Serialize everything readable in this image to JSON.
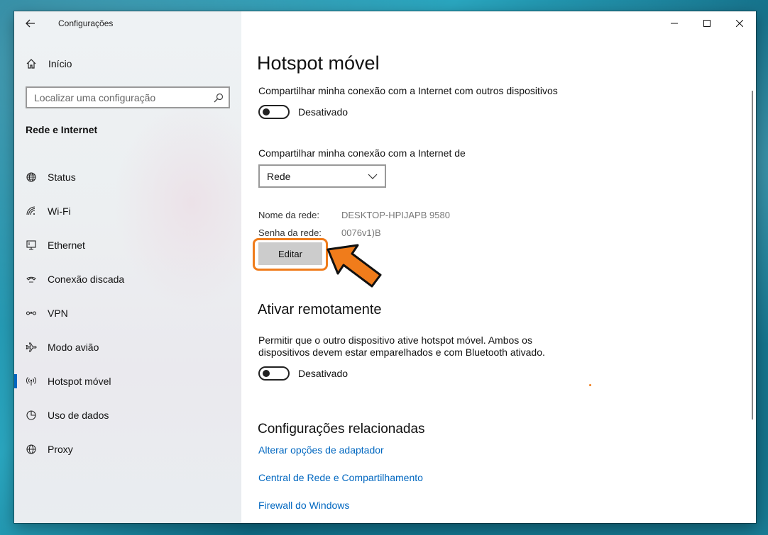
{
  "window": {
    "app_title": "Configurações"
  },
  "sidebar": {
    "home_label": "Início",
    "search_placeholder": "Localizar uma configuração",
    "section_title": "Rede e Internet",
    "items": [
      {
        "label": "Status",
        "icon": "globe-status-icon"
      },
      {
        "label": "Wi-Fi",
        "icon": "wifi-icon"
      },
      {
        "label": "Ethernet",
        "icon": "ethernet-icon"
      },
      {
        "label": "Conexão discada",
        "icon": "dialup-icon"
      },
      {
        "label": "VPN",
        "icon": "vpn-icon"
      },
      {
        "label": "Modo avião",
        "icon": "airplane-icon"
      },
      {
        "label": "Hotspot móvel",
        "icon": "hotspot-icon",
        "active": true
      },
      {
        "label": "Uso de dados",
        "icon": "data-usage-icon"
      },
      {
        "label": "Proxy",
        "icon": "globe-icon"
      }
    ]
  },
  "main": {
    "title": "Hotspot móvel",
    "share_label": "Compartilhar minha conexão com a Internet com outros dispositivos",
    "share_toggle_state": "Desativado",
    "share_from_label": "Compartilhar minha conexão com a Internet de",
    "share_from_selected": "Rede",
    "network_name_key": "Nome da rede:",
    "network_name_value": "DESKTOP-HPIJAPB 9580",
    "network_password_key": "Senha da rede:",
    "network_password_value": "0076v1)B",
    "edit_button": "Editar",
    "remote_title": "Ativar remotamente",
    "remote_desc_line1": "Permitir que o outro dispositivo ative hotspot móvel. Ambos os",
    "remote_desc_line2": "dispositivos devem estar emparelhados e com Bluetooth ativado.",
    "remote_toggle_state": "Desativado",
    "related_title": "Configurações relacionadas",
    "links": [
      "Alterar opções de adaptador",
      "Central de Rede e Compartilhamento",
      "Firewall do Windows"
    ]
  },
  "colors": {
    "accent": "#0067c0",
    "highlight": "#f07c1b"
  }
}
